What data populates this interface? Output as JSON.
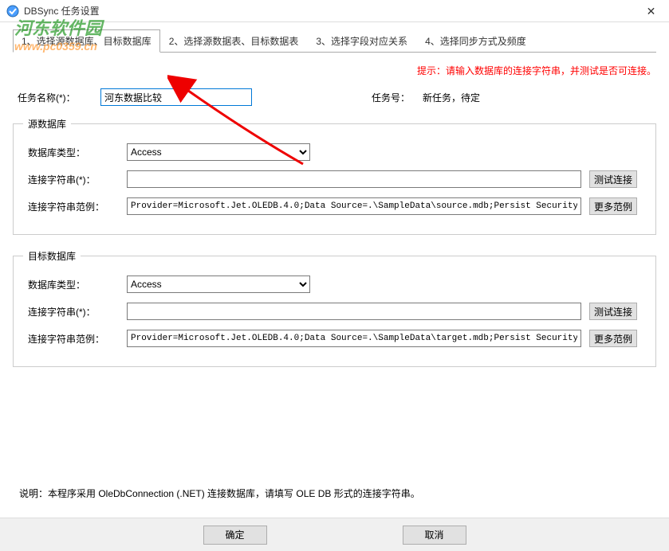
{
  "window": {
    "title": "DBSync 任务设置"
  },
  "watermark": {
    "line1": "河东软件园",
    "line2": "www.pc0359.cn"
  },
  "tabs": [
    {
      "label": "1、选择源数据库、目标数据库",
      "active": true
    },
    {
      "label": "2、选择源数据表、目标数据表",
      "active": false
    },
    {
      "label": "3、选择字段对应关系",
      "active": false
    },
    {
      "label": "4、选择同步方式及频度",
      "active": false
    }
  ],
  "hint": "提示：请输入数据库的连接字符串，并测试是否可连接。",
  "task": {
    "name_label": "任务名称(*)：",
    "name_value": "河东数据比较",
    "num_label": "任务号：",
    "num_value": "新任务，待定"
  },
  "source_db": {
    "legend": "源数据库",
    "type_label": "数据库类型：",
    "type_value": "Access",
    "conn_label": "连接字符串(*)：",
    "conn_value": "",
    "test_btn": "测试连接",
    "example_label": "连接字符串范例：",
    "example_value": "Provider=Microsoft.Jet.OLEDB.4.0;Data Source=.\\SampleData\\source.mdb;Persist Security Info=Fa",
    "more_btn": "更多范例"
  },
  "target_db": {
    "legend": "目标数据库",
    "type_label": "数据库类型：",
    "type_value": "Access",
    "conn_label": "连接字符串(*)：",
    "conn_value": "",
    "test_btn": "测试连接",
    "example_label": "连接字符串范例：",
    "example_value": "Provider=Microsoft.Jet.OLEDB.4.0;Data Source=.\\SampleData\\target.mdb;Persist Security Info=Fa",
    "more_btn": "更多范例"
  },
  "note": "说明：本程序采用 OleDbConnection (.NET) 连接数据库，请填写 OLE DB 形式的连接字符串。",
  "footer": {
    "ok": "确定",
    "cancel": "取消"
  }
}
